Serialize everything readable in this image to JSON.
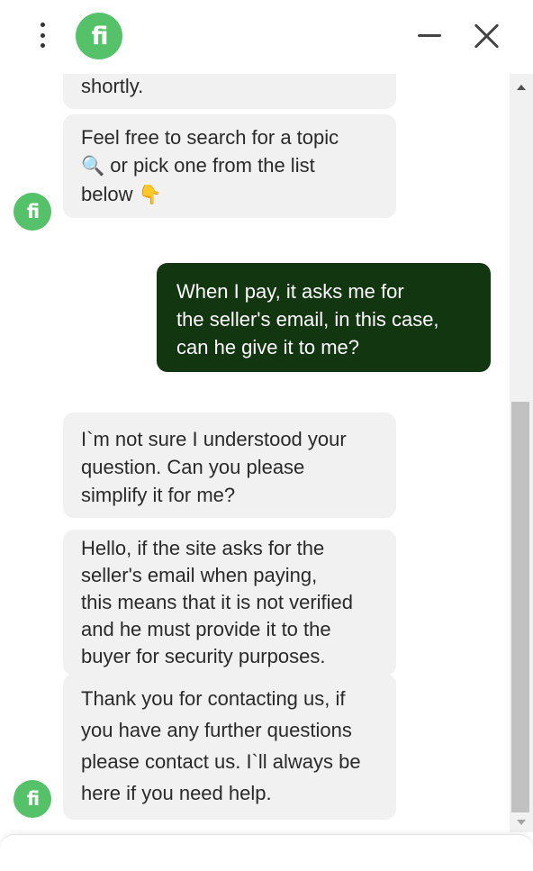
{
  "header": {
    "menu_icon": "kebab-menu-icon",
    "logo_text": "fi",
    "minimize_icon": "minimize-icon",
    "close_icon": "close-icon"
  },
  "messages": [
    {
      "from": "bot",
      "text": "shortly."
    },
    {
      "from": "bot",
      "text_before": "Feel free to search for a topic",
      "icon1": "🔍",
      "text_mid": " or pick one from the list\nbelow ",
      "icon2": "👇"
    },
    {
      "from": "user",
      "text": "When I pay, it asks me for\nthe seller's email, in this case,\ncan he give it to me?"
    },
    {
      "from": "bot",
      "text": "I`m not sure I understood your\nquestion. Can you please\nsimplify it for me?"
    },
    {
      "from": "bot",
      "text": "Hello, if the site asks for the\nseller's email when paying,\nthis means that it is not verified\nand he must provide it to the\nbuyer for security purposes."
    },
    {
      "from": "bot",
      "text": "Thank you for contacting us, if\nyou have any further questions\nplease contact us. I`ll always be\nhere if you need help."
    }
  ],
  "avatar_text": "fi",
  "colors": {
    "brand_green": "#55c26a",
    "user_bubble": "#123610",
    "bot_bubble": "#f1f1f1"
  }
}
